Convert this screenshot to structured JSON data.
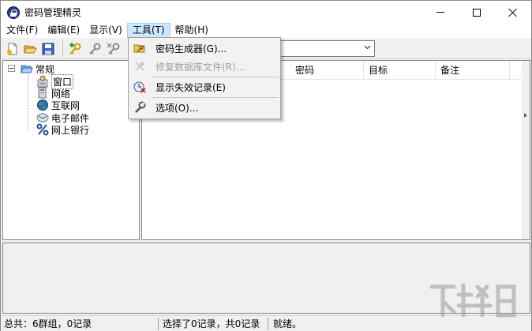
{
  "window": {
    "title": "密码管理精灵",
    "controls": [
      "minimize-icon",
      "maximize-icon",
      "close-icon"
    ]
  },
  "menubar": {
    "items": [
      {
        "label": "文件(F)"
      },
      {
        "label": "编辑(E)"
      },
      {
        "label": "显示(V)"
      },
      {
        "label": "工具(T)",
        "active": true
      },
      {
        "label": "帮助(H)"
      }
    ]
  },
  "toolbar": {
    "buttons": [
      "new-file-icon",
      "open-folder-icon",
      "save-icon",
      "add-key-icon",
      "edit-key-icon",
      "delete-key-icon"
    ],
    "combo_value": ""
  },
  "tools_menu": {
    "items": [
      {
        "label": "密码生成器(G)...",
        "icon": "key-folder-icon",
        "enabled": true
      },
      {
        "label": "修复数据库文件(R)...",
        "icon": "repair-tools-icon",
        "enabled": false
      },
      {
        "label": "显示失效记录(E)",
        "icon": "expired-records-icon",
        "enabled": true
      },
      {
        "label": "选项(O)...",
        "icon": "wrench-icon",
        "enabled": true
      }
    ]
  },
  "tree": {
    "root": {
      "label": "常规",
      "icon": "folder-open-icon"
    },
    "children": [
      {
        "label": "窗口",
        "icon": "window-person-icon",
        "selected": true
      },
      {
        "label": "网络",
        "icon": "network-computer-icon"
      },
      {
        "label": "互联网",
        "icon": "globe-icon"
      },
      {
        "label": "电子邮件",
        "icon": "email-icon"
      },
      {
        "label": "网上银行",
        "icon": "percent-bank-icon"
      }
    ]
  },
  "list": {
    "columns": [
      {
        "label": "密码"
      },
      {
        "label": "目标"
      },
      {
        "label": "备注"
      }
    ]
  },
  "statusbar": {
    "groups": "总共：6群组，0记录",
    "selection": "选择了0记录，共0记录",
    "state": "就绪。"
  },
  "colors": {
    "menu_highlight": "#cce8ff",
    "menu_highlight_border": "#99d1ff",
    "panel_border": "#828790"
  }
}
